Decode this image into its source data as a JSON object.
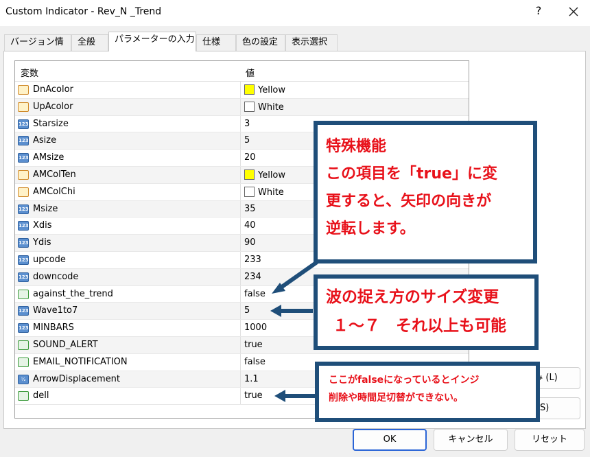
{
  "window": {
    "title": "Custom Indicator - Rev_N _Trend",
    "help": "?",
    "close": "✕"
  },
  "tabs": [
    {
      "label": "バージョン情報"
    },
    {
      "label": "全般"
    },
    {
      "label": "パラメーターの入力"
    },
    {
      "label": "仕様"
    },
    {
      "label": "色の設定"
    },
    {
      "label": "表示選択"
    }
  ],
  "grid": {
    "col_name": "変数",
    "col_value": "値",
    "rows": [
      {
        "name": "DnAcolor",
        "value": "Yellow",
        "icon": "color-icon",
        "swatch": "#ffff00"
      },
      {
        "name": "UpAcolor",
        "value": "White",
        "icon": "color-icon",
        "swatch": "#ffffff"
      },
      {
        "name": "Starsize",
        "value": "3",
        "icon": "int-icon"
      },
      {
        "name": "Asize",
        "value": "5",
        "icon": "int-icon"
      },
      {
        "name": "AMsize",
        "value": "20",
        "icon": "int-icon"
      },
      {
        "name": "AMColTen",
        "value": "Yellow",
        "icon": "color-icon",
        "swatch": "#ffff00"
      },
      {
        "name": "AMColChi",
        "value": "White",
        "icon": "color-icon",
        "swatch": "#ffffff"
      },
      {
        "name": "Msize",
        "value": "35",
        "icon": "int-icon"
      },
      {
        "name": "Xdis",
        "value": "40",
        "icon": "int-icon"
      },
      {
        "name": "Ydis",
        "value": "90",
        "icon": "int-icon"
      },
      {
        "name": "upcode",
        "value": "233",
        "icon": "int-icon"
      },
      {
        "name": "downcode",
        "value": "234",
        "icon": "int-icon"
      },
      {
        "name": "against_the_trend",
        "value": "false",
        "icon": "bool-icon"
      },
      {
        "name": "Wave1to7",
        "value": "5",
        "icon": "int-icon"
      },
      {
        "name": "MINBARS",
        "value": "1000",
        "icon": "int-icon"
      },
      {
        "name": "SOUND_ALERT",
        "value": "true",
        "icon": "bool-icon"
      },
      {
        "name": "EMAIL_NOTIFICATION",
        "value": "false",
        "icon": "bool-icon"
      },
      {
        "name": "ArrowDisplacement",
        "value": "1.1",
        "icon": "double-icon"
      },
      {
        "name": "dell",
        "value": "true",
        "icon": "bool-icon"
      }
    ]
  },
  "icon_text": {
    "int": "123",
    "double": "½"
  },
  "buttons": {
    "load": "読み込み (L)",
    "save": "保存 (S)",
    "ok": "OK",
    "cancel": "キャンセル",
    "reset": "リセット"
  },
  "callouts": {
    "c1_lines": [
      "特殊機能",
      "この項目を「true」に変",
      "更すると、矢印の向きが",
      "逆転します。"
    ],
    "c2_lines": [
      "波の捉え方のサイズ変更",
      "１～７　それ以上も可能"
    ],
    "c3_lines": [
      "ここがfalseになっているとインジ",
      "削除や時間足切替ができない。"
    ]
  },
  "colors": {
    "accent": "#2a64d6",
    "callout_border": "#1f4e79",
    "callout_text": "#e8111a"
  }
}
